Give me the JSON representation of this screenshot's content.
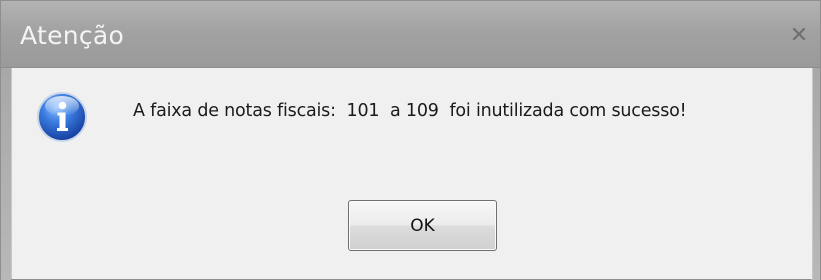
{
  "dialog": {
    "title": "Atenção",
    "close_glyph": "x",
    "icon": "info-icon",
    "message": "A faixa de notas fiscais:  101  a 109  foi inutilizada com sucesso!",
    "ok_label": "OK"
  },
  "colors": {
    "titlebar": "#a2a2a2",
    "body": "#f0f0f0",
    "icon_blue": "#2a62c9"
  }
}
